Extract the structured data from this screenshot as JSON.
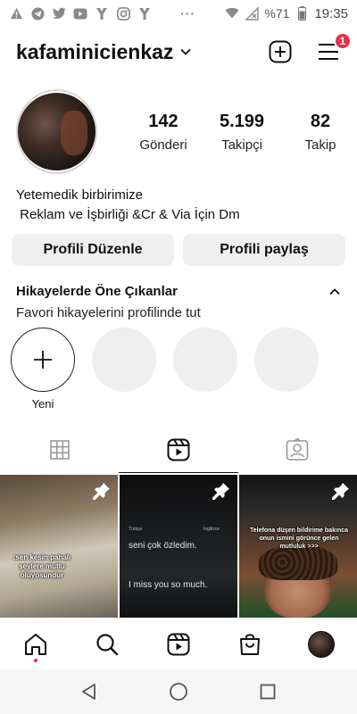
{
  "status_bar": {
    "battery": "%71",
    "time": "19:35",
    "dots": "···",
    "icons": [
      "warning-icon",
      "telegram-icon",
      "twitter-icon",
      "youtube-icon",
      "sim-icon",
      "instagram-icon",
      "sim-icon",
      "wifi-icon",
      "no-signal-icon",
      "battery-icon"
    ]
  },
  "header": {
    "username": "kafaminicienkaz",
    "notification_count": "1"
  },
  "profile": {
    "stats": [
      {
        "value": "142",
        "label": "Gönderi"
      },
      {
        "value": "5.199",
        "label": "Takipçi"
      },
      {
        "value": "82",
        "label": "Takip"
      }
    ],
    "bio_line1": "Yetemedik birbirimize",
    "bio_line2": " Reklam ve İşbirliği &Cr & Via İçin Dm"
  },
  "actions": {
    "edit_label": "Profili Düzenle",
    "share_label": "Profili paylaş"
  },
  "highlights": {
    "title": "Hikayelerde Öne Çıkanlar",
    "subtitle": "Favori hikayelerini profilinde tut",
    "new_label": "Yeni"
  },
  "posts": [
    {
      "caption": ":sen kesin pahalı şeylere mutlu oluyosundur"
    },
    {
      "line1": "seni çok özledim.",
      "line2": "I miss you so much.",
      "lang_from": "Türkçe",
      "lang_to": "İngilizce"
    },
    {
      "caption": "Telefona düşen bildirime bakınca onun ismini görünce gelen mutluluk >>>"
    }
  ],
  "colors": {
    "accent_red": "#ed2d44",
    "button_bg": "#efefef",
    "text": "#111111"
  }
}
